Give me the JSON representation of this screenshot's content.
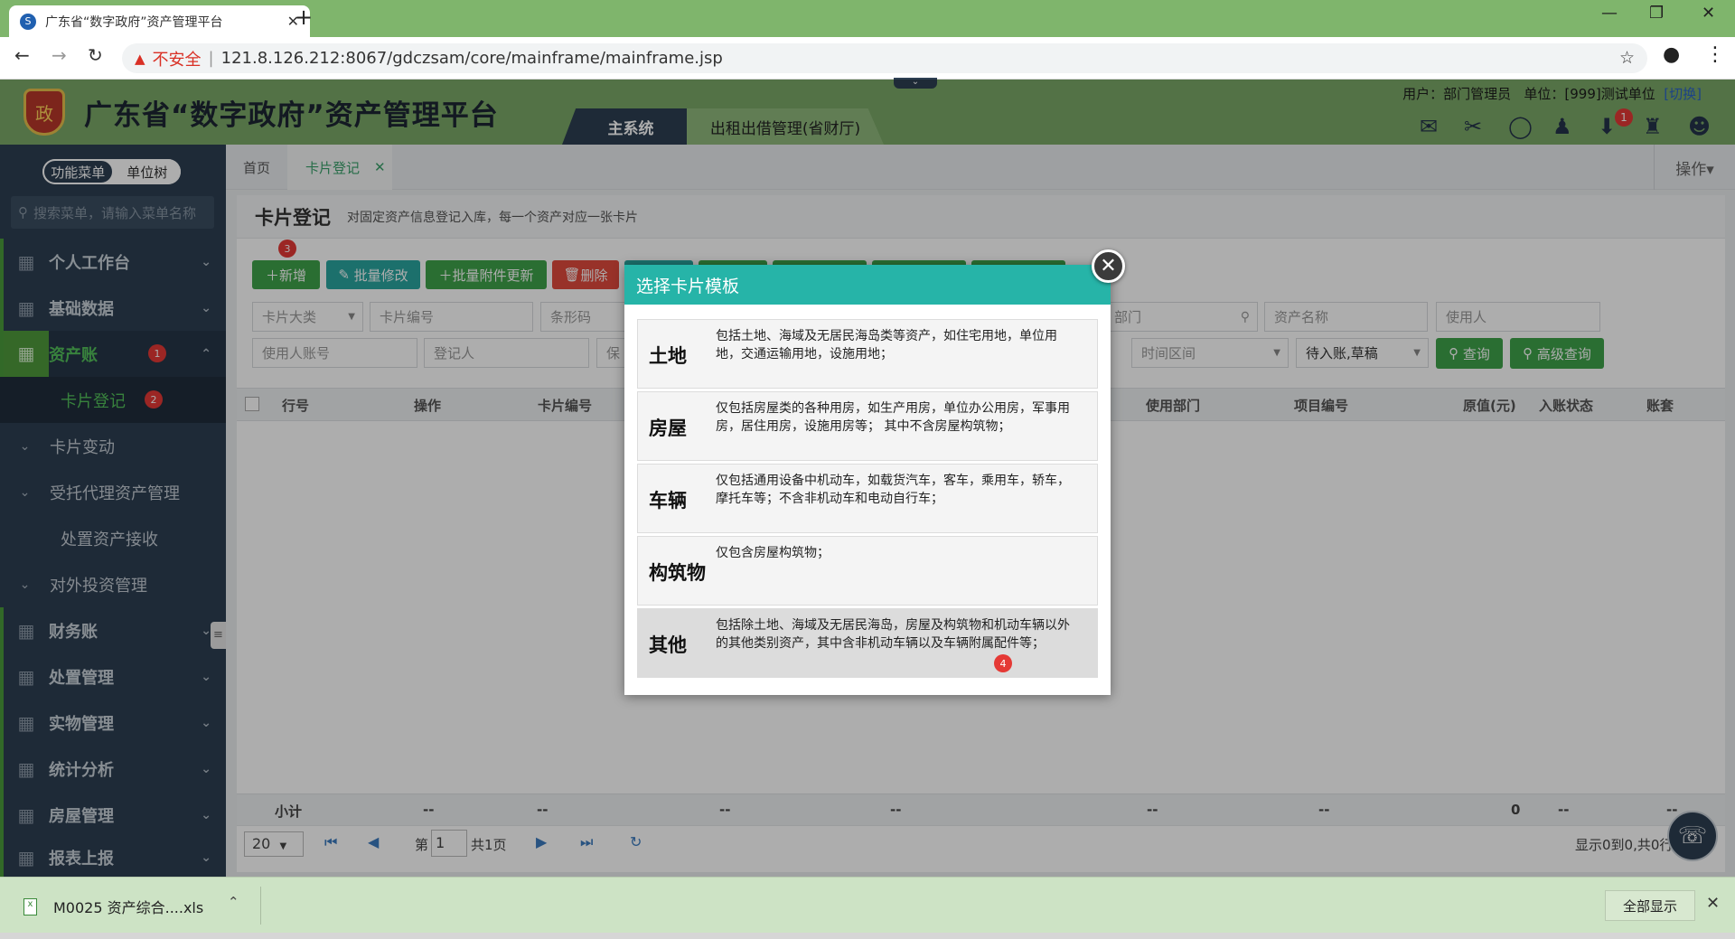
{
  "browser": {
    "tab_title": "广东省“数字政府”资产管理平台",
    "tab_close": "✕",
    "new_tab": "+",
    "insecure": "不安全",
    "url": "121.8.126.212:8067/gdczsam/core/mainframe/mainframe.jsp"
  },
  "app": {
    "logo_text": "政",
    "title": "广东省“数字政府”资产管理平台",
    "system_tabs": [
      "主系统",
      "出租出借管理(省财厅)"
    ],
    "user_label": "用户：部门管理员",
    "unit_label": "单位：[999]测试单位",
    "switch_label": "[切换]",
    "download_badge": "1"
  },
  "sidebar": {
    "switch": [
      "功能菜单",
      "单位树"
    ],
    "search_placeholder": "搜索菜单，请输入菜单名称",
    "items": [
      {
        "label": "个人工作台"
      },
      {
        "label": "基础数据"
      },
      {
        "label": "资产账",
        "badge": "1"
      },
      {
        "label": "卡片登记",
        "badge": "2"
      },
      {
        "label": "卡片变动"
      },
      {
        "label": "受托代理资产管理"
      },
      {
        "label": "处置资产接收"
      },
      {
        "label": "对外投资管理"
      },
      {
        "label": "财务账"
      },
      {
        "label": "处置管理"
      },
      {
        "label": "实物管理"
      },
      {
        "label": "统计分析"
      },
      {
        "label": "房屋管理"
      },
      {
        "label": "报表上报"
      }
    ]
  },
  "content_tabs": {
    "home": "首页",
    "active": "卡片登记",
    "close": "✕",
    "ops": "操作▾"
  },
  "panel": {
    "title": "卡片登记",
    "desc": "对固定资产信息登记入库，每一个资产对应一张卡片",
    "add_badge": "3",
    "buttons": {
      "add": "新增",
      "batch_edit": "批量修改",
      "batch_attach": "批量附件更新",
      "delete": "删除",
      "query": "查询",
      "adv_query": "高级查询"
    },
    "filters": {
      "card_category": "卡片大类",
      "card_no": "卡片编号",
      "barcode": "条形码",
      "dept": "部门",
      "asset_name": "资产名称",
      "user": "使用人",
      "user_account": "使用人账号",
      "registrant": "登记人",
      "keeper": "保",
      "time_range": "时间区间",
      "status": "待入账,草稿"
    },
    "columns": [
      "行号",
      "操作",
      "卡片编号",
      "使用部门",
      "项目编号",
      "原值(元)",
      "入账状态",
      "账套"
    ],
    "subtotal_label": "小计",
    "subtotal_dash": "--",
    "subtotal_zero": "0",
    "pager": {
      "size": "20",
      "page_prefix": "第",
      "page": "1",
      "total": "共1页",
      "summary": "显示0到0,共0行记录"
    }
  },
  "modal": {
    "title": "选择卡片模板",
    "close": "✕",
    "hover_badge": "4",
    "options": [
      {
        "name": "土地",
        "desc": "包括土地、海域及无居民海岛类等资产，如住宅用地，单位用地，交通运输用地，设施用地；"
      },
      {
        "name": "房屋",
        "desc": "仅包括房屋类的各种用房，如生产用房，单位办公用房，军事用房，居住用房，设施用房等； 其中不含房屋构筑物；"
      },
      {
        "name": "车辆",
        "desc": "仅包括通用设备中机动车，如载货汽车，客车，乘用车，轿车，摩托车等；不含非机动车和电动自行车；"
      },
      {
        "name": "构筑物",
        "desc": "仅包含房屋构筑物；"
      },
      {
        "name": "其他",
        "desc": "包括除土地、海域及无居民海岛，房屋及构筑物和机动车辆以外的其他类别资产，其中含非机动车辆以及车辆附属配件等；"
      }
    ]
  },
  "shelf": {
    "file": "M0025 资产综合....xls",
    "show_all": "全部显示",
    "close": "✕"
  }
}
